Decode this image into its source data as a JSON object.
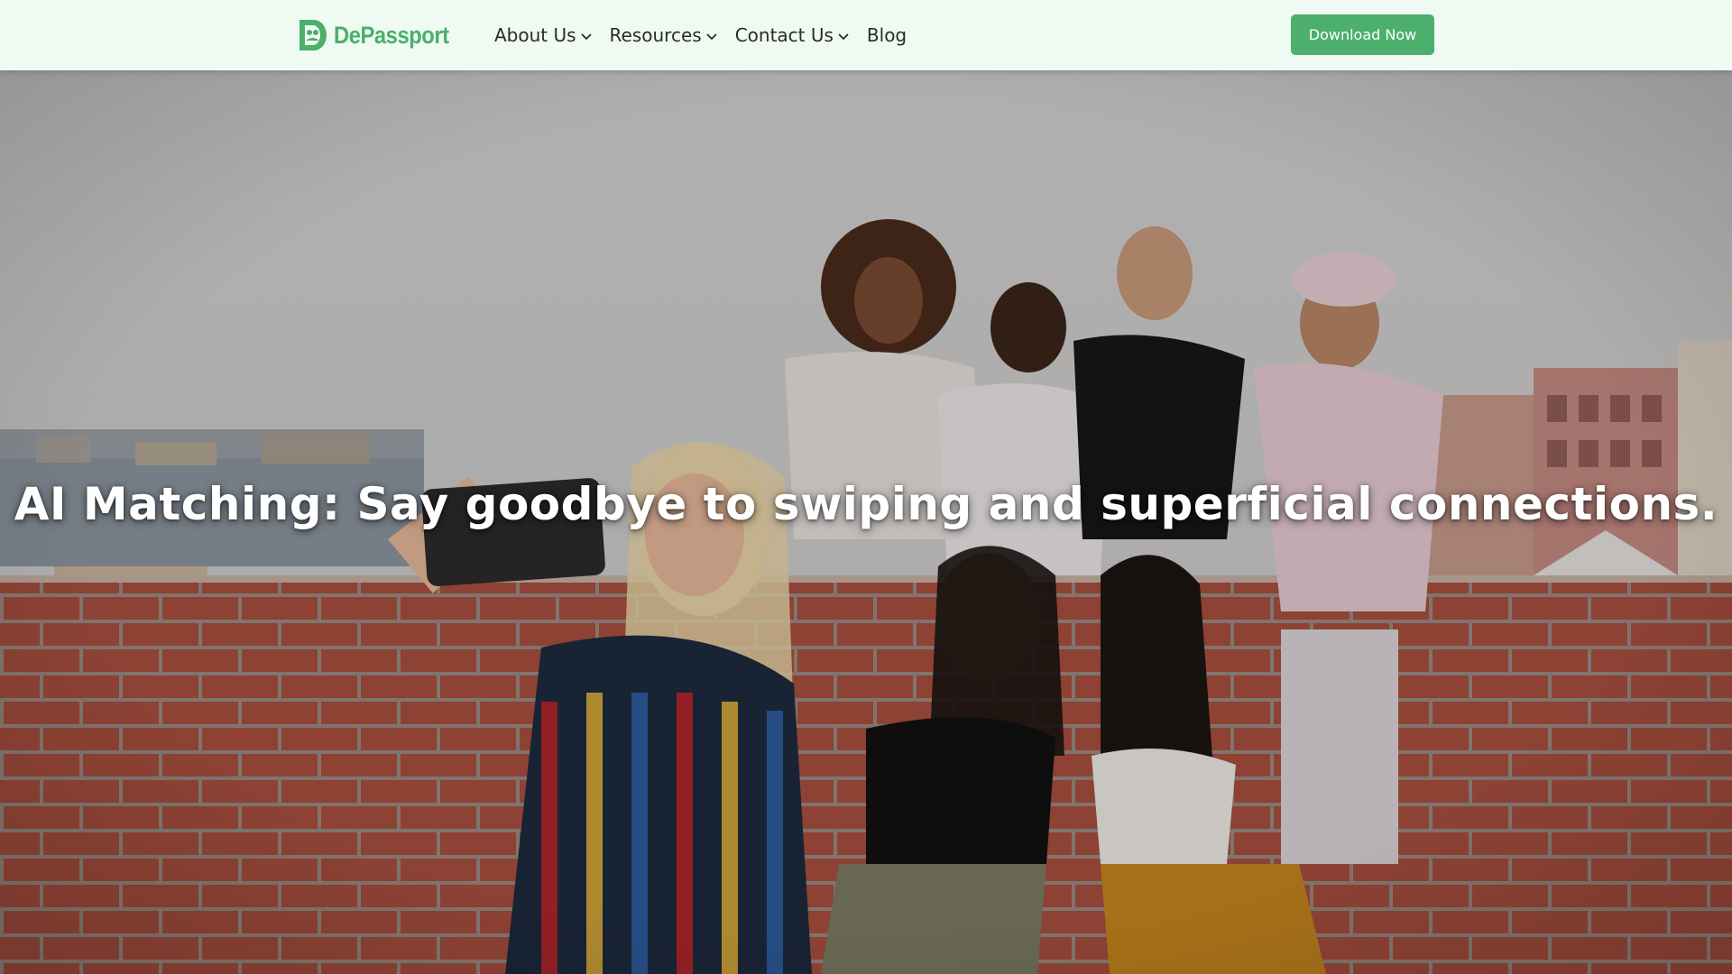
{
  "header": {
    "logo_text": "DePassport",
    "logo_icon": "depassport-logo-icon",
    "nav": [
      {
        "label": "About Us",
        "has_dropdown": true
      },
      {
        "label": "Resources",
        "has_dropdown": true
      },
      {
        "label": "Contact Us",
        "has_dropdown": true
      },
      {
        "label": "Blog",
        "has_dropdown": false
      }
    ],
    "cta_label": "Download Now"
  },
  "hero": {
    "title": "AI Matching: Say goodbye to swiping and superficial connections."
  },
  "colors": {
    "brand_green": "#4caf6b",
    "header_bg": "#effbf2",
    "nav_text": "#2a2a2a"
  }
}
